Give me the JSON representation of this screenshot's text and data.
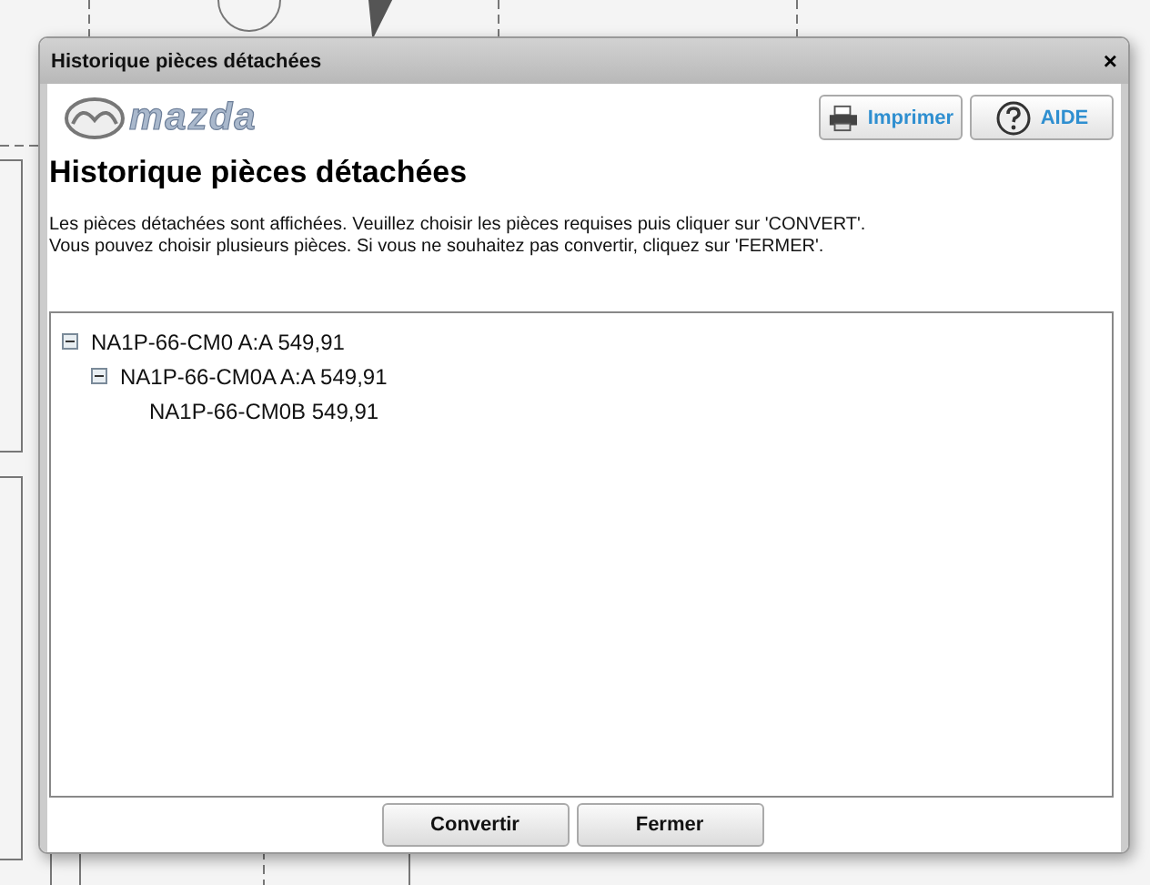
{
  "window": {
    "title": "Historique pièces détachées",
    "close": "×"
  },
  "logo": {
    "text": "mazda"
  },
  "toolbar": [
    {
      "label": "Imprimer",
      "kind": "print"
    },
    {
      "label": "AIDE",
      "kind": "help"
    }
  ],
  "heading": "Historique pièces détachées",
  "instructions": [
    "Les pièces détachées sont affichées. Veuillez choisir les pièces requises puis cliquer sur 'CONVERT'.",
    "Vous pouvez choisir plusieurs pièces. Si vous ne souhaitez pas convertir, cliquez sur 'FERMER'."
  ],
  "tree": [
    {
      "label": "NA1P-66-CM0 A:A 549,91",
      "expanded": true,
      "children": [
        {
          "label": "NA1P-66-CM0A A:A 549,91",
          "expanded": true,
          "children": [
            {
              "label": "NA1P-66-CM0B 549,91"
            }
          ]
        }
      ]
    }
  ],
  "buttons": [
    "Convertir",
    "Fermer"
  ]
}
